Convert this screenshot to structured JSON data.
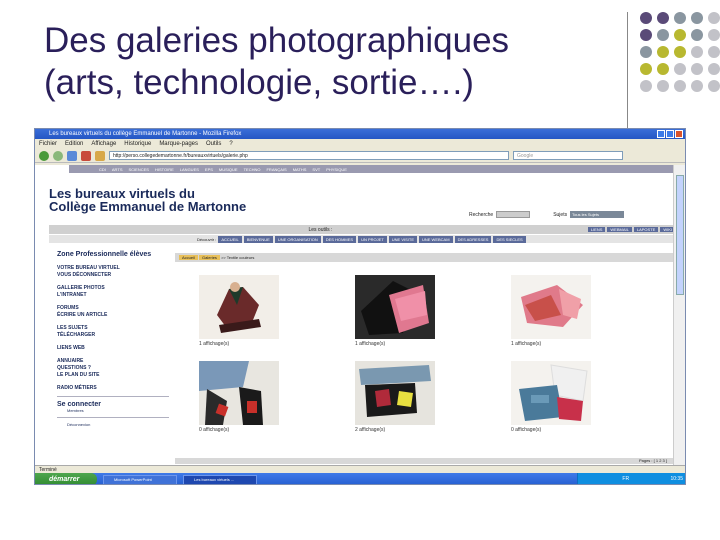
{
  "slide": {
    "title_line1": "Des galeries photographiques",
    "title_line2": "(arts, technologie, sortie….)",
    "dot_colors": [
      "#5a4a78",
      "#5a4a78",
      "#8a96a0",
      "#8a96a0",
      "#c2c2c8",
      "#5a4a78",
      "#8a96a0",
      "#b8b830",
      "#8a96a0",
      "#c2c2c8",
      "#8a96a0",
      "#b8b830",
      "#b8b830",
      "#c2c2c8",
      "#c2c2c8",
      "#b8b830",
      "#b8b830",
      "#c2c2c8",
      "#c2c2c8",
      "#c2c2c8",
      "#c2c2c8",
      "#c2c2c8",
      "#c2c2c8",
      "#c2c2c8",
      "#c2c2c8"
    ]
  },
  "browser": {
    "title": "Les bureaux virtuels du collège Emmanuel de Martonne - Mozilla Firefox",
    "menu": [
      "Fichier",
      "Edition",
      "Affichage",
      "Historique",
      "Marque-pages",
      "Outils",
      "?"
    ],
    "url": "http://perso.collegedemartonne.fr/bureauxvirtuels/galerie.php",
    "search_placeholder": "Google",
    "status": "Terminé"
  },
  "site": {
    "title_line1": "Les bureaux virtuels du",
    "title_line2": "Collège Emmanuel de Martonne",
    "nav": [
      "CDI",
      "ARTS",
      "SCIENCES",
      "HISTOIRE",
      "LANGUES",
      "EPS",
      "MUSIQUE",
      "TECHNO",
      "FRANÇAIS",
      "MATHS",
      "SVT",
      "PHYSIQUE"
    ],
    "search_label": "Recherche",
    "subjects_label": "Sujets",
    "subjects_value": "Tous les Sujets",
    "tools_label": "Les outils :",
    "tools": [
      "LIENS",
      "WEBMAIL",
      "LAPOSTE",
      "WIKI"
    ],
    "discover_label": "Découvrir :",
    "discover": [
      "ACCUEIL",
      "BIENVENUE",
      "UNE ORGANISATION",
      "DES HOMMES",
      "UN PROJET",
      "UNE VISITE",
      "UNE WEBCAM",
      "DES ADRESSES",
      "DES SIECLES"
    ]
  },
  "sidebar": {
    "heading": "Zone Professionnelle élèves",
    "links1": [
      "VOTRE BUREAU VIRTUEL",
      "VOUS DÉCONNECTER"
    ],
    "links2": [
      "GALLERIE PHOTOS",
      "L'INTRANET"
    ],
    "links3": [
      "FORUMS",
      "ÉCRIRE UN ARTICLE"
    ],
    "links4": [
      "LES SUJETS",
      "TÉLÉCHARGER"
    ],
    "links5": [
      "LIENS WEB"
    ],
    "links6": [
      "ANNUAIRE",
      "QUESTIONS ?",
      "LE PLAN DU SITE"
    ],
    "links7": [
      "RADIO MÉTIERS"
    ],
    "connect": "Se connecter",
    "members": "Membres",
    "logout": "Déconnexion"
  },
  "gallery": {
    "breadcrumb_home": "Accueil",
    "breadcrumb_section": "Galeries",
    "breadcrumb_current": ">> Textile couleurs",
    "captions": [
      "1 affichage(s)",
      "1 affichage(s)",
      "1 affichage(s)",
      "0 affichage(s)",
      "2 affichage(s)",
      "0 affichage(s)"
    ],
    "pager": "Pages : [ 1 2 3 ]"
  },
  "taskbar": {
    "start": "démarrer",
    "task1": "Microsoft PowerPoint",
    "task2": "Les bureaux virtuels ...",
    "lang": "FR",
    "clock": "10:35"
  }
}
